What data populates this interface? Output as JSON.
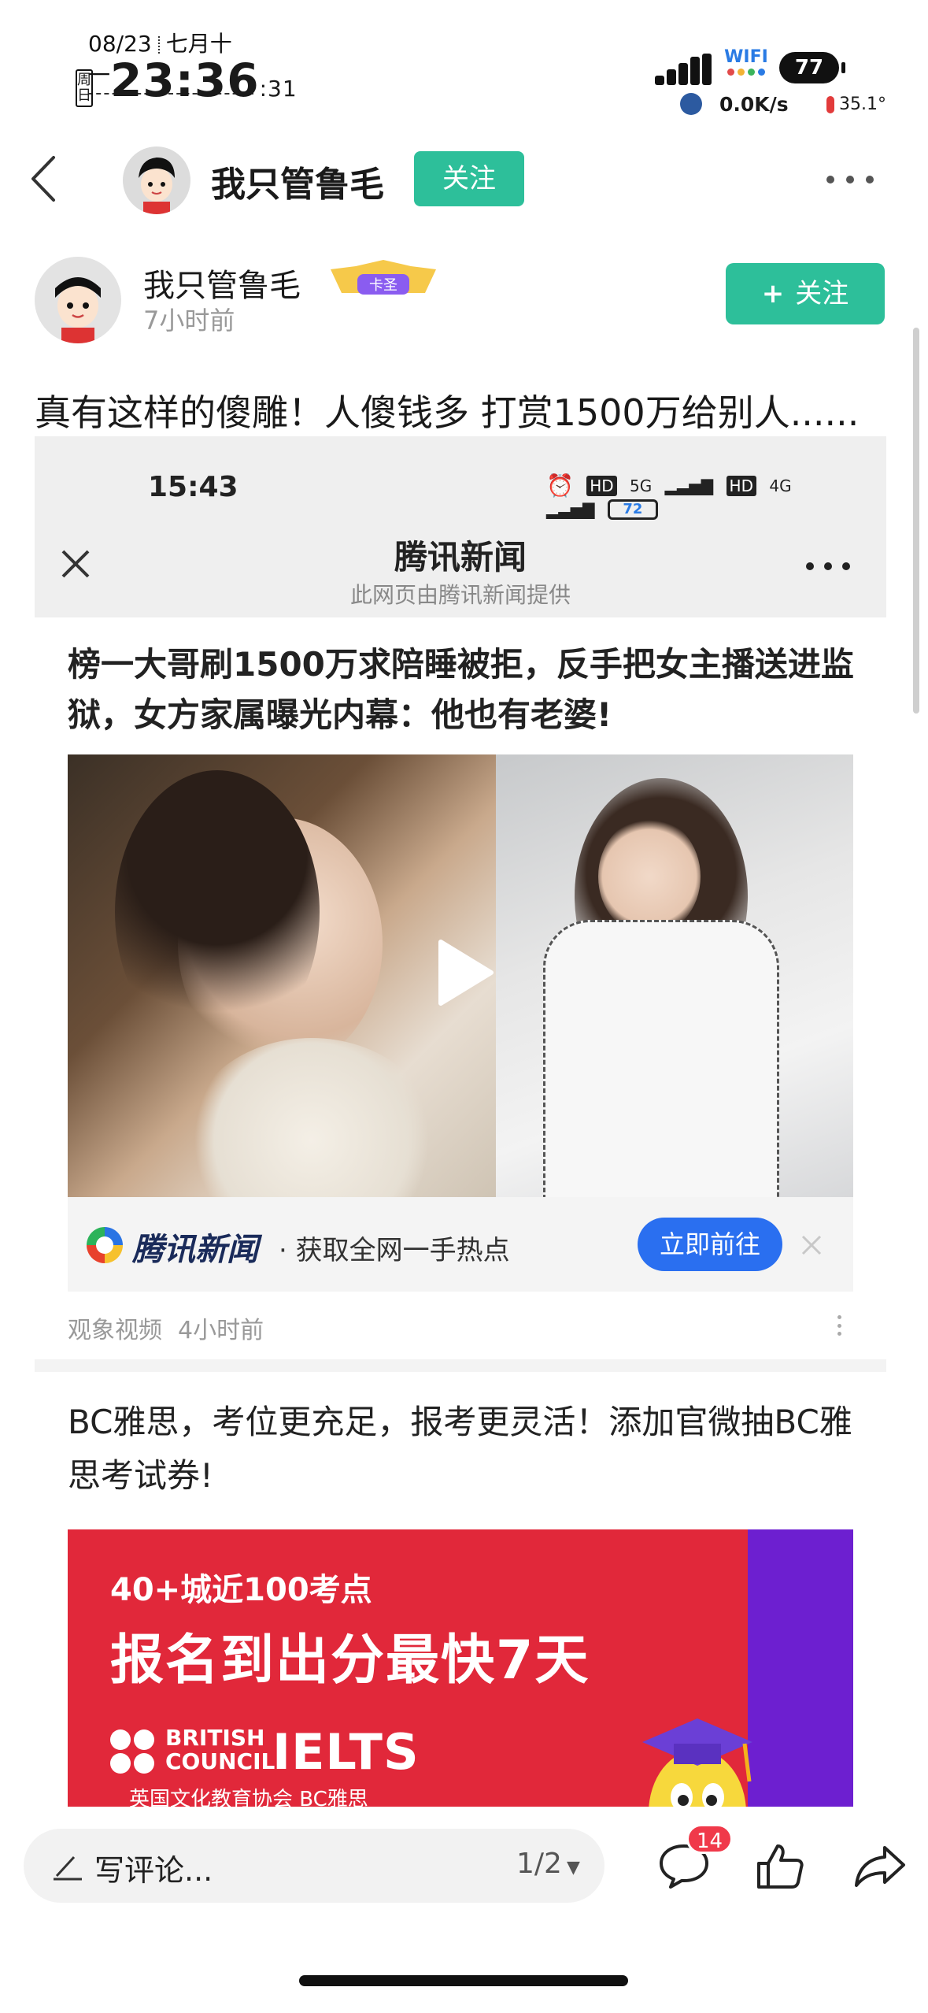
{
  "status_bar": {
    "date": "08/23",
    "lunar": "七月十一",
    "weekday": "周日",
    "time": "23:36",
    "seconds": ":31",
    "wifi_label": "WIFI",
    "battery": "77",
    "net_speed": "0.0K/s",
    "temperature": "35.1°"
  },
  "nav": {
    "name": "我只管鲁毛",
    "follow_label": "关注"
  },
  "author": {
    "name": "我只管鲁毛",
    "badge": "卡圣",
    "time": "7小时前",
    "follow_label": "关注"
  },
  "post": {
    "title": "真有这样的傻雕！人傻钱多 打赏1500万给别人......"
  },
  "screenshot": {
    "time": "15:43",
    "net1": "5G",
    "net2": "4G",
    "battery": "72",
    "title": "腾讯新闻",
    "subtitle": "此网页由腾讯新闻提供",
    "article_headline": "榜一大哥刷1500万求陪睡被拒，反手把女主播送进监狱，女方家属曝光内幕：他也有老婆!",
    "promo_brand": "腾讯新闻",
    "promo_text": "· 获取全网一手热点",
    "promo_button": "立即前往",
    "source": "观象视频",
    "source_time": "4小时前",
    "ad_headline": "BC雅思，考位更充足，报考更灵活！添加官微抽BC雅思考试券!",
    "ad_line1": "40+城近100考点",
    "ad_line2": "报名到出分最快7天",
    "ad_bc_line1": "BRITISH",
    "ad_bc_line2": "COUNCIL",
    "ad_ielts": "IELTS",
    "ad_cn": "英国文化教育协会 BC雅思"
  },
  "bottom_bar": {
    "comment_placeholder": "写评论...",
    "page_indicator": "1/2",
    "comment_count": "14"
  },
  "colors": {
    "accent_green": "#2dbf9a",
    "button_blue": "#2a6ff0",
    "ad_red": "#e1283a",
    "badge_red": "#f0394a"
  }
}
